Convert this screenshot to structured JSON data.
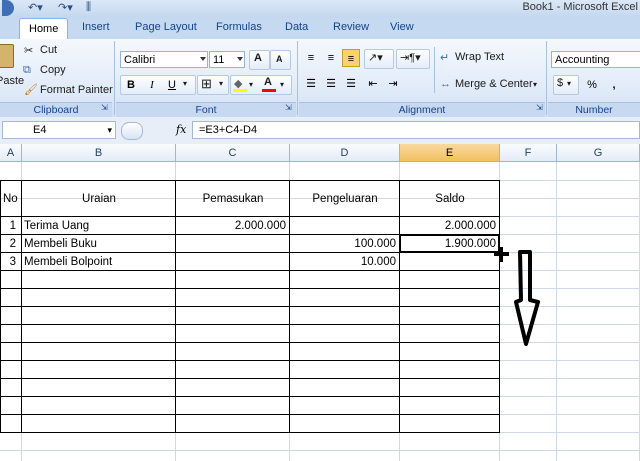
{
  "window": {
    "title": "Book1 - Microsoft Excel"
  },
  "quick_access": {
    "undo_icon": "undo-icon",
    "redo_icon": "redo-icon",
    "customize_icon": "customize-icon"
  },
  "tabs": [
    {
      "label": "Home",
      "active": true
    },
    {
      "label": "Insert"
    },
    {
      "label": "Page Layout"
    },
    {
      "label": "Formulas"
    },
    {
      "label": "Data"
    },
    {
      "label": "Review"
    },
    {
      "label": "View"
    }
  ],
  "ribbon": {
    "clipboard": {
      "paste_label": "Paste",
      "cut": "Cut",
      "copy": "Copy",
      "format_painter": "Format Painter",
      "group": "Clipboard"
    },
    "font": {
      "name": "Calibri",
      "size": "11",
      "bold": "B",
      "italic": "I",
      "underline": "U",
      "group": "Font",
      "grow_label": "A",
      "shrink_label": "A",
      "font_color_label": "A"
    },
    "alignment": {
      "wrap_text": "Wrap Text",
      "merge_center": "Merge & Center",
      "group": "Alignment"
    },
    "number": {
      "format": "Accounting",
      "currency_label": "$",
      "percent_label": "%",
      "comma_label": ",",
      "group": "Number"
    },
    "colors": {
      "accent": "#15428b",
      "tab_bg": "#c5d9f1"
    }
  },
  "formula_bar": {
    "name_box": "E4",
    "fx": "fx",
    "formula": "=E3+C4-D4"
  },
  "columns": [
    {
      "label": "A"
    },
    {
      "label": "B"
    },
    {
      "label": "C"
    },
    {
      "label": "D"
    },
    {
      "label": "E",
      "selected": true
    },
    {
      "label": "F"
    },
    {
      "label": "G"
    }
  ],
  "table": {
    "headers": {
      "no": "No",
      "uraian": "Uraian",
      "pemasukan": "Pemasukan",
      "pengeluaran": "Pengeluaran",
      "saldo": "Saldo"
    },
    "rows": [
      {
        "no": "1",
        "uraian": "Terima Uang",
        "pemasukan": "2.000.000",
        "pengeluaran": "",
        "saldo": "2.000.000"
      },
      {
        "no": "2",
        "uraian": "Membeli Buku",
        "pemasukan": "",
        "pengeluaran": "100.000",
        "saldo": "1.900.000"
      },
      {
        "no": "3",
        "uraian": "Membeli Bolpoint",
        "pemasukan": "",
        "pengeluaran": "10.000",
        "saldo": ""
      }
    ]
  },
  "annotation": {
    "arrow_icon": "down-arrow-icon",
    "cursor_icon": "fill-handle-cursor-icon"
  }
}
